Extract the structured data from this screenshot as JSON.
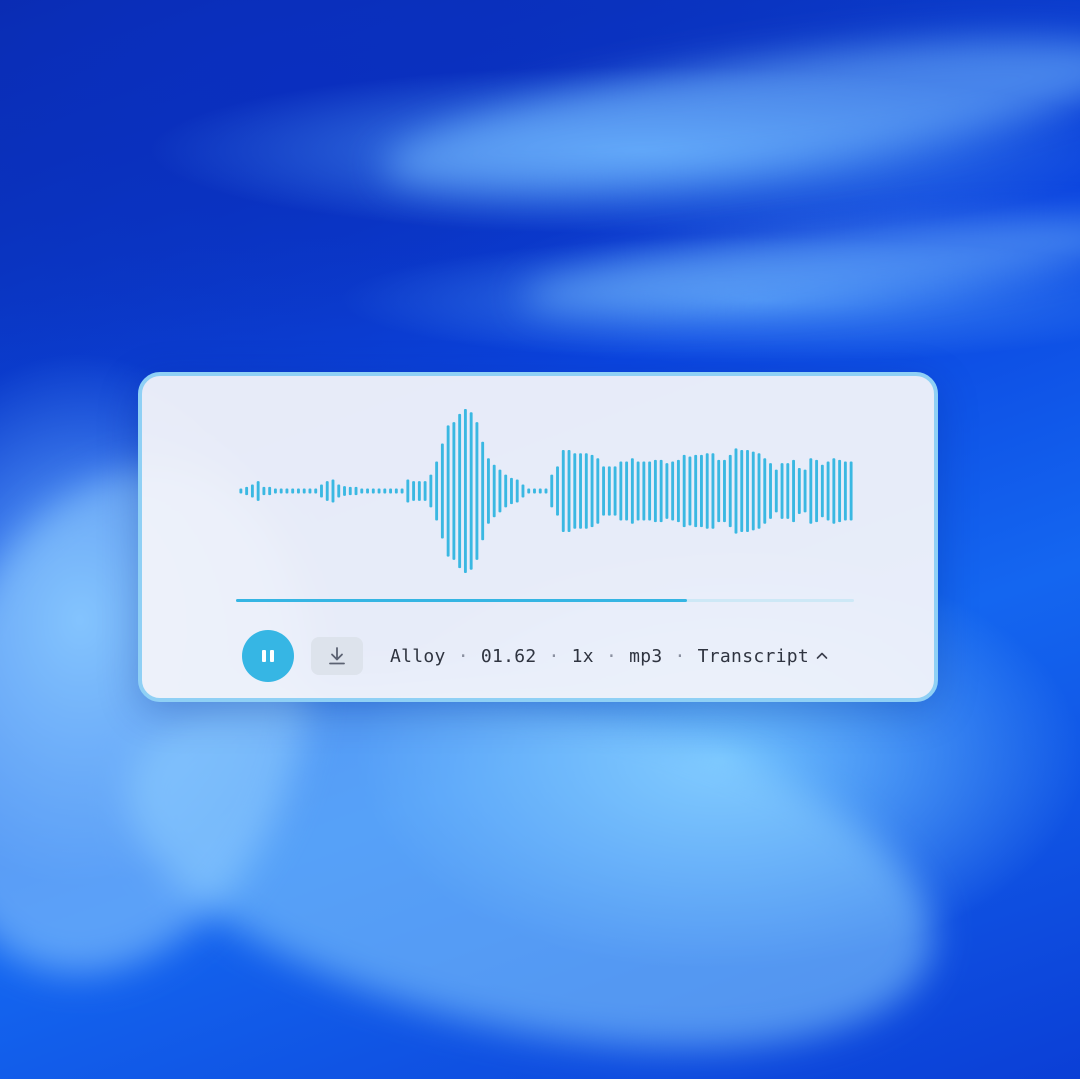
{
  "player": {
    "voice": "Alloy",
    "time": "01.62",
    "speed": "1x",
    "format": "mp3",
    "transcript_label": "Transcript",
    "separator": "·",
    "progress": 0.73,
    "accent_color": "#36b6e4",
    "icons": {
      "play_state": "pause-icon",
      "download": "download-icon",
      "transcript_toggle": "chevron-up-icon"
    }
  },
  "waveform": {
    "amplitudes": [
      0.03,
      0.05,
      0.08,
      0.12,
      0.05,
      0.05,
      0.03,
      0.03,
      0.03,
      0.03,
      0.03,
      0.03,
      0.03,
      0.03,
      0.08,
      0.12,
      0.14,
      0.08,
      0.06,
      0.05,
      0.05,
      0.03,
      0.03,
      0.03,
      0.03,
      0.03,
      0.03,
      0.03,
      0.03,
      0.14,
      0.12,
      0.12,
      0.12,
      0.2,
      0.36,
      0.58,
      0.8,
      0.84,
      0.94,
      1.0,
      0.96,
      0.84,
      0.6,
      0.4,
      0.32,
      0.26,
      0.2,
      0.16,
      0.14,
      0.08,
      0.03,
      0.03,
      0.03,
      0.03,
      0.2,
      0.3,
      0.5,
      0.5,
      0.46,
      0.46,
      0.46,
      0.44,
      0.4,
      0.3,
      0.3,
      0.3,
      0.36,
      0.36,
      0.4,
      0.36,
      0.36,
      0.36,
      0.38,
      0.38,
      0.34,
      0.36,
      0.38,
      0.44,
      0.42,
      0.44,
      0.44,
      0.46,
      0.46,
      0.38,
      0.38,
      0.44,
      0.52,
      0.5,
      0.5,
      0.48,
      0.46,
      0.4,
      0.34,
      0.26,
      0.34,
      0.34,
      0.38,
      0.28,
      0.26,
      0.4,
      0.38,
      0.32,
      0.36,
      0.4,
      0.38,
      0.36,
      0.36
    ]
  }
}
